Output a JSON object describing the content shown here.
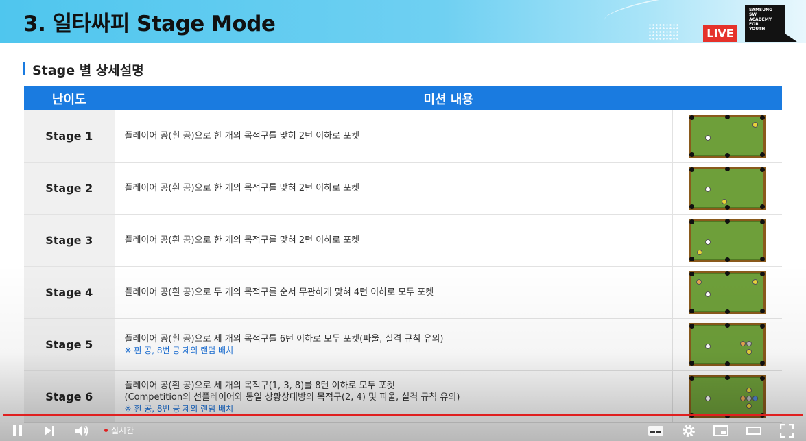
{
  "header": {
    "title": "3. 일타싸피 Stage Mode",
    "live_badge": "LIVE",
    "logo_lines": [
      "SAMSUNG",
      "SW",
      "ACADEMY",
      "FOR",
      "YOUTH"
    ]
  },
  "section": {
    "title": "Stage 별 상세설명"
  },
  "table": {
    "headers": [
      "난이도",
      "미션 내용"
    ],
    "rows": [
      {
        "stage": "Stage 1",
        "lines": [
          "플레이어 공(흰 공)으로 한 개의 목적구를 맞혀 2턴 이하로 포켓"
        ],
        "note": ""
      },
      {
        "stage": "Stage 2",
        "lines": [
          "플레이어 공(흰 공)으로 한 개의 목적구를 맞혀 2턴 이하로 포켓"
        ],
        "note": ""
      },
      {
        "stage": "Stage 3",
        "lines": [
          "플레이어 공(흰 공)으로 한 개의 목적구를 맞혀 2턴 이하로 포켓"
        ],
        "note": ""
      },
      {
        "stage": "Stage 4",
        "lines": [
          "플레이어 공(흰 공)으로 두 개의 목적구를 순서 무관하게 맞혀 4턴 이하로 모두 포켓"
        ],
        "note": ""
      },
      {
        "stage": "Stage 5",
        "lines": [
          "플레이어 공(흰 공)으로 세 개의 목적구를 6턴 이하로 모두 포켓(파울, 실격 규칙 유의)"
        ],
        "note": "※ 흰 공, 8번 공 제외 랜덤 배치"
      },
      {
        "stage": "Stage 6",
        "lines": [
          "플레이어 공(흰 공)으로 세 개의 목적구(1, 3, 8)를 8턴 이하로 모두 포켓",
          "(Competition의 선플레이어와 동일 상황상대방의 목적구(2, 4) 및 파울, 실격 규칙 유의)"
        ],
        "note": "※ 흰 공, 8번 공 제외 랜덤 배치"
      }
    ]
  },
  "colors": {
    "accent": "#1a7be0",
    "live": "#e5322b",
    "table_felt": "#6e9f3a",
    "table_rail": "#8a5a1c",
    "progress": "#e02020"
  },
  "player": {
    "live_label": "실시간",
    "icons": [
      "pause-icon",
      "next-icon",
      "volume-icon",
      "subtitles-icon",
      "settings-icon",
      "miniplayer-icon",
      "theater-icon",
      "fullscreen-icon"
    ]
  }
}
